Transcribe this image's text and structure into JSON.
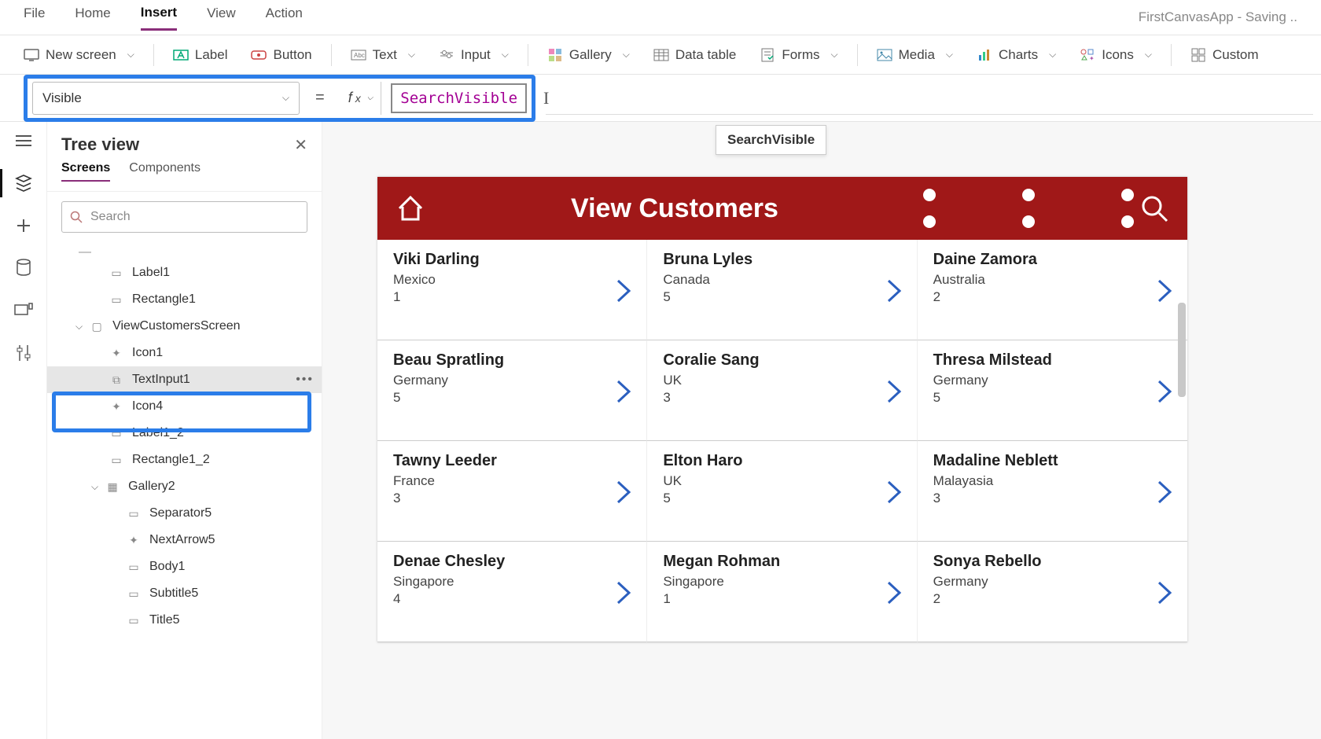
{
  "menu": {
    "file": "File",
    "home": "Home",
    "insert": "Insert",
    "view": "View",
    "action": "Action"
  },
  "appStatus": "FirstCanvasApp - Saving ..",
  "ribbon": {
    "newScreen": "New screen",
    "label": "Label",
    "button": "Button",
    "text": "Text",
    "input": "Input",
    "gallery": "Gallery",
    "dataTable": "Data table",
    "forms": "Forms",
    "media": "Media",
    "charts": "Charts",
    "icons": "Icons",
    "custom": "Custom"
  },
  "formula": {
    "property": "Visible",
    "value": "SearchVisible",
    "intellisense": "SearchVisible"
  },
  "tree": {
    "title": "Tree view",
    "tabs": {
      "screens": "Screens",
      "components": "Components"
    },
    "searchPlaceholder": "Search",
    "nodes": {
      "label1": "Label1",
      "rectangle1": "Rectangle1",
      "viewCustomersScreen": "ViewCustomersScreen",
      "icon1": "Icon1",
      "textInput1": "TextInput1",
      "icon4": "Icon4",
      "label1_2": "Label1_2",
      "rectangle1_2": "Rectangle1_2",
      "gallery2": "Gallery2",
      "separator5": "Separator5",
      "nextArrow5": "NextArrow5",
      "body1": "Body1",
      "subtitle5": "Subtitle5",
      "title5": "Title5"
    }
  },
  "app": {
    "title": "View Customers",
    "customers": [
      {
        "name": "Viki  Darling",
        "country": "Mexico",
        "num": "1"
      },
      {
        "name": "Bruna  Lyles",
        "country": "Canada",
        "num": "5"
      },
      {
        "name": "Daine  Zamora",
        "country": "Australia",
        "num": "2"
      },
      {
        "name": "Beau  Spratling",
        "country": "Germany",
        "num": "5"
      },
      {
        "name": "Coralie  Sang",
        "country": "UK",
        "num": "3"
      },
      {
        "name": "Thresa  Milstead",
        "country": "Germany",
        "num": "5"
      },
      {
        "name": "Tawny  Leeder",
        "country": "France",
        "num": "3"
      },
      {
        "name": "Elton  Haro",
        "country": "UK",
        "num": "5"
      },
      {
        "name": "Madaline  Neblett",
        "country": "Malayasia",
        "num": "3"
      },
      {
        "name": "Denae  Chesley",
        "country": "Singapore",
        "num": "4"
      },
      {
        "name": "Megan  Rohman",
        "country": "Singapore",
        "num": "1"
      },
      {
        "name": "Sonya  Rebello",
        "country": "Germany",
        "num": "2"
      }
    ]
  }
}
